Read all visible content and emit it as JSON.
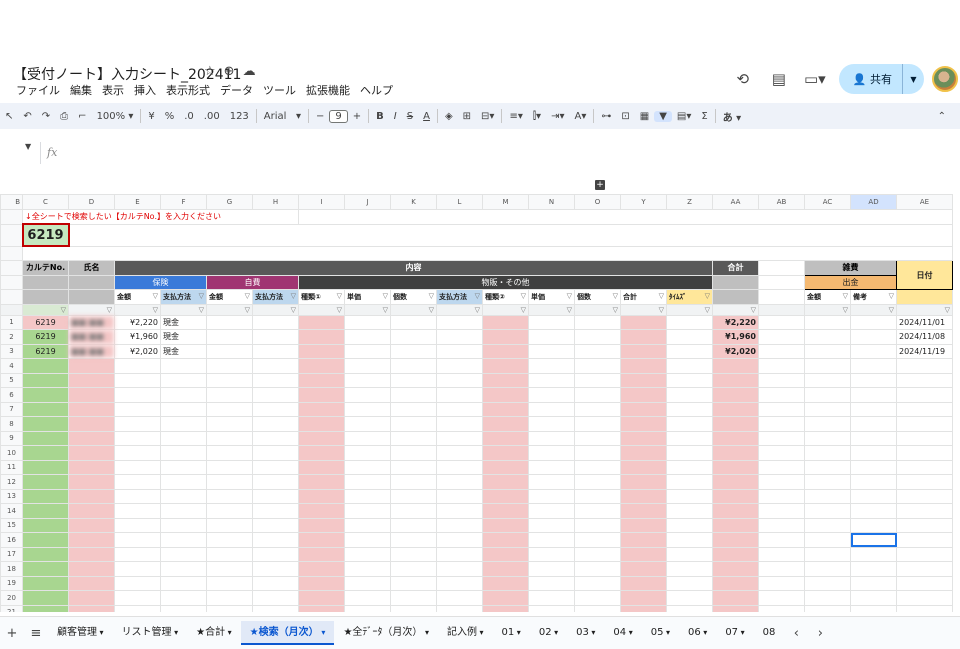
{
  "doc": {
    "title": "【受付ノート】入力シート_202411",
    "star_icon": "☆",
    "menu": [
      "ファイル",
      "編集",
      "表示",
      "挿入",
      "表示形式",
      "データ",
      "ツール",
      "拡張機能",
      "ヘルプ"
    ]
  },
  "topright": {
    "share_label": "共有"
  },
  "toolbar": {
    "zoom": "100%",
    "currency": "¥",
    "percent": "%",
    "dec_dec": ".0",
    "dec_inc": ".00",
    "format_123": "123",
    "font": "Arial",
    "font_size": "9",
    "bold": "B",
    "italic": "I",
    "underline": "A",
    "input_mode": "あ"
  },
  "formula": {
    "fx": "fx"
  },
  "columns": [
    "B",
    "C",
    "D",
    "E",
    "F",
    "G",
    "H",
    "I",
    "J",
    "K",
    "L",
    "M",
    "N",
    "O",
    "Y",
    "Z",
    "AA",
    "AB",
    "AC",
    "AD",
    "AE"
  ],
  "sheet": {
    "note": "↓全シートで検索したい【カルテNo.】を入力ください",
    "search_value": "6219",
    "hdr_karte": "カルテNo.",
    "hdr_name": "氏名",
    "hdr_naiyo": "内容",
    "hdr_total": "合計",
    "hdr_zappi": "雑費",
    "hdr_date": "日付",
    "hdr_hoken": "保険",
    "hdr_jihi": "自費",
    "hdr_buppan": "物販・その他",
    "hdr_shukkin": "出金",
    "sub": {
      "kingaku": "金額",
      "shiharai": "支払方法",
      "shurui1": "種類①",
      "tanka": "単価",
      "kosu": "個数",
      "shurui2": "種類②",
      "gokei": "合計",
      "taimuzu": "ﾀｲﾑｽﾞ",
      "biko": "備考"
    },
    "rows": [
      {
        "n": "1",
        "karte": "6219",
        "name": "■■ ■■",
        "kin": "¥2,220",
        "pay": "現金",
        "total": "¥2,220",
        "date": "2024/11/01"
      },
      {
        "n": "2",
        "karte": "6219",
        "name": "■■ ■■",
        "kin": "¥1,960",
        "pay": "現金",
        "total": "¥1,960",
        "date": "2024/11/08"
      },
      {
        "n": "3",
        "karte": "6219",
        "name": "■■ ■■",
        "kin": "¥2,020",
        "pay": "現金",
        "total": "¥2,020",
        "date": "2024/11/19"
      }
    ],
    "empty_row_numbers": [
      "4",
      "5",
      "6",
      "7",
      "8",
      "9",
      "10",
      "11",
      "12",
      "13",
      "14",
      "15",
      "16",
      "17",
      "18",
      "19",
      "20",
      "21"
    ]
  },
  "tabs": [
    "顧客管理",
    "リスト管理",
    "★合計",
    "★検索（月次）",
    "★全ﾃﾞｰﾀ（月次）",
    "記入例",
    "01",
    "02",
    "03",
    "04",
    "05",
    "06",
    "07",
    "08"
  ],
  "active_tab": "★検索（月次）"
}
